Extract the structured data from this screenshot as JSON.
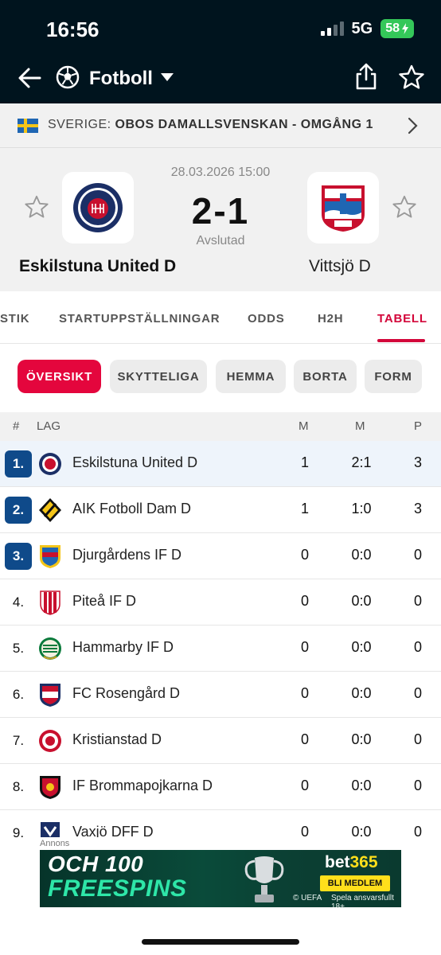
{
  "status_bar": {
    "time": "16:56",
    "network": "5G",
    "battery": "58"
  },
  "header": {
    "sport_label": "Fotboll",
    "icons": [
      "back-arrow-icon",
      "soccer-ball-icon",
      "chevron-down-icon",
      "share-icon",
      "star-icon"
    ]
  },
  "league": {
    "country": "SVERIGE:",
    "competition": "OBOS DAMALLSVENSKAN - OMGÅNG 1"
  },
  "match": {
    "date": "28.03.2026 15:00",
    "score": "2-1",
    "status": "Avslutad",
    "home": {
      "name": "Eskilstuna United D"
    },
    "away": {
      "name": "Vittsjö D"
    }
  },
  "tabs": [
    "STIK",
    "STARTUPPSTÄLLNINGAR",
    "ODDS",
    "H2H",
    "TABELL"
  ],
  "active_tab": "TABELL",
  "filters": [
    "ÖVERSIKT",
    "SKYTTELIGA",
    "HEMMA",
    "BORTA",
    "FORM"
  ],
  "active_filter": "ÖVERSIKT",
  "table": {
    "headers": {
      "rank": "#",
      "team": "LAG",
      "matches": "M",
      "goals": "M",
      "points": "P"
    },
    "rows": [
      {
        "rank": "1.",
        "team": "Eskilstuna United D",
        "m": "1",
        "goals": "2:1",
        "p": "3",
        "badge": true,
        "highlight": true,
        "crest": "eskilstuna-crest"
      },
      {
        "rank": "2.",
        "team": "AIK Fotboll Dam D",
        "m": "1",
        "goals": "1:0",
        "p": "3",
        "badge": true,
        "highlight": false,
        "crest": "aik-crest"
      },
      {
        "rank": "3.",
        "team": "Djurgårdens IF D",
        "m": "0",
        "goals": "0:0",
        "p": "0",
        "badge": true,
        "highlight": false,
        "crest": "djurgarden-crest"
      },
      {
        "rank": "4.",
        "team": "Piteå IF D",
        "m": "0",
        "goals": "0:0",
        "p": "0",
        "badge": false,
        "highlight": false,
        "crest": "pitea-crest"
      },
      {
        "rank": "5.",
        "team": "Hammarby IF D",
        "m": "0",
        "goals": "0:0",
        "p": "0",
        "badge": false,
        "highlight": false,
        "crest": "hammarby-crest"
      },
      {
        "rank": "6.",
        "team": "FC Rosengård D",
        "m": "0",
        "goals": "0:0",
        "p": "0",
        "badge": false,
        "highlight": false,
        "crest": "rosengard-crest"
      },
      {
        "rank": "7.",
        "team": "Kristianstad D",
        "m": "0",
        "goals": "0:0",
        "p": "0",
        "badge": false,
        "highlight": false,
        "crest": "kristianstad-crest"
      },
      {
        "rank": "8.",
        "team": "IF Brommapojkarna D",
        "m": "0",
        "goals": "0:0",
        "p": "0",
        "badge": false,
        "highlight": false,
        "crest": "brommapojkarna-crest"
      },
      {
        "rank": "9.",
        "team": "Vaxjö DFF D",
        "m": "0",
        "goals": "0:0",
        "p": "0",
        "badge": false,
        "highlight": false,
        "crest": "vaxjo-crest"
      }
    ]
  },
  "ad": {
    "label": "Annons",
    "line1": "OCH 100",
    "line2": "FREESPINS",
    "brand_a": "bet",
    "brand_b": "365",
    "cta": "BLI MEDLEM",
    "uefa": "© UEFA",
    "responsible": "Spela ansvarsfullt 18+"
  },
  "colors": {
    "header_bg": "#00141e",
    "accent": "#e4063d",
    "rank_badge": "#0f4a8a",
    "highlight_row": "#eef4fb"
  }
}
